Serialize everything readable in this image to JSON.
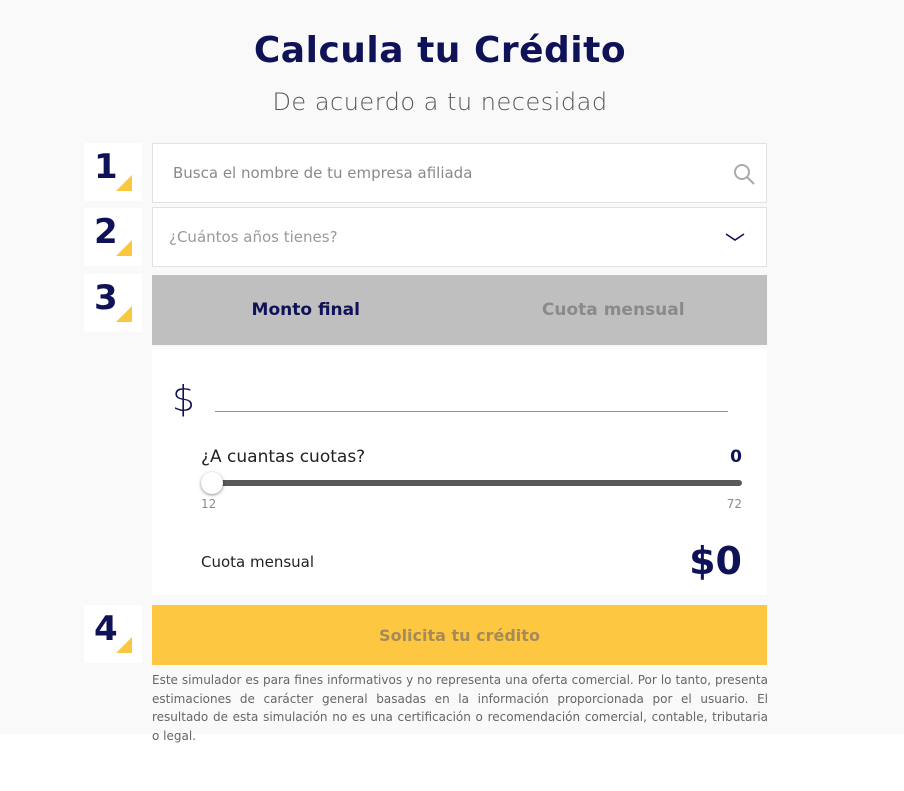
{
  "header": {
    "title": "Calcula tu Crédito",
    "subtitle": "De acuerdo a tu necesidad"
  },
  "steps": {
    "step1": "1",
    "step2": "2",
    "step3": "3",
    "step4": "4"
  },
  "search": {
    "placeholder": "Busca el nombre de tu empresa afiliada",
    "value": "",
    "icon": "search-icon"
  },
  "age_select": {
    "placeholder": "¿Cuántos años tienes?",
    "icon": "chevron-down-icon"
  },
  "tabs": [
    {
      "label": "Monto final",
      "active": true
    },
    {
      "label": "Cuota mensual",
      "active": false
    }
  ],
  "amount": {
    "currency_symbol": "$",
    "value": ""
  },
  "installments": {
    "question": "¿A cuantas cuotas?",
    "value": "0",
    "min_label": "12",
    "max_label": "72",
    "slider_level": 0
  },
  "monthly": {
    "label": "Cuota mensual",
    "value": "$0"
  },
  "submit": {
    "label": "Solicita tu crédito"
  },
  "disclaimer": "Este simulador es para fines informativos y no representa una oferta comercial. Por lo tanto, presenta estimaciones de carácter general basadas en la información proporcionada por el usuario. El resultado de esta simulación no es una certificación o recomendación comercial, contable, tributaria o legal.",
  "colors": {
    "brand_navy": "#0f1257",
    "accent_yellow": "#fdc741",
    "tab_bar_gray": "#bfbfbf"
  }
}
